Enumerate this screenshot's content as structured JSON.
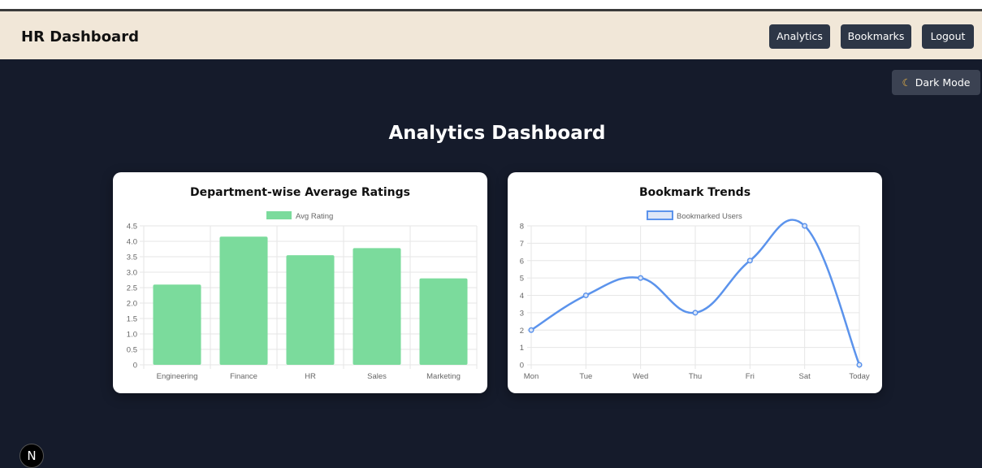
{
  "app": {
    "title": "HR Dashboard"
  },
  "nav": {
    "analytics": "Analytics",
    "bookmarks": "Bookmarks",
    "logout": "Logout"
  },
  "theme_toggle": {
    "label": "Dark Mode",
    "icon": "moon-icon"
  },
  "page": {
    "title": "Analytics Dashboard"
  },
  "dev_badge": {
    "label": "N"
  },
  "colors": {
    "navbar_bg": "#f1e7d8",
    "page_bg": "#151b2b",
    "button_bg": "#2d3646",
    "bar_fill": "#7bdb9c",
    "line_stroke": "#5b93ec"
  },
  "chart_data": [
    {
      "type": "bar",
      "title": "Department-wise Average Ratings",
      "categories": [
        "Engineering",
        "Finance",
        "HR",
        "Sales",
        "Marketing"
      ],
      "series": [
        {
          "name": "Avg Rating",
          "values": [
            2.6,
            4.15,
            3.55,
            3.78,
            2.8
          ]
        }
      ],
      "ylim": [
        0,
        4.5
      ],
      "yticks": [
        "0",
        "0.5",
        "1.0",
        "1.5",
        "2.0",
        "2.5",
        "3.0",
        "3.5",
        "4.0",
        "4.5"
      ],
      "grid": true,
      "legend": "top-center"
    },
    {
      "type": "line",
      "title": "Bookmark Trends",
      "categories": [
        "Mon",
        "Tue",
        "Wed",
        "Thu",
        "Fri",
        "Sat",
        "Today"
      ],
      "series": [
        {
          "name": "Bookmarked Users",
          "values": [
            2,
            4,
            5,
            3,
            6,
            8,
            0
          ]
        }
      ],
      "ylim": [
        0,
        8
      ],
      "yticks": [
        "0",
        "1",
        "2",
        "3",
        "4",
        "5",
        "6",
        "7",
        "8"
      ],
      "grid": true,
      "legend": "top-center",
      "smooth": true
    }
  ]
}
